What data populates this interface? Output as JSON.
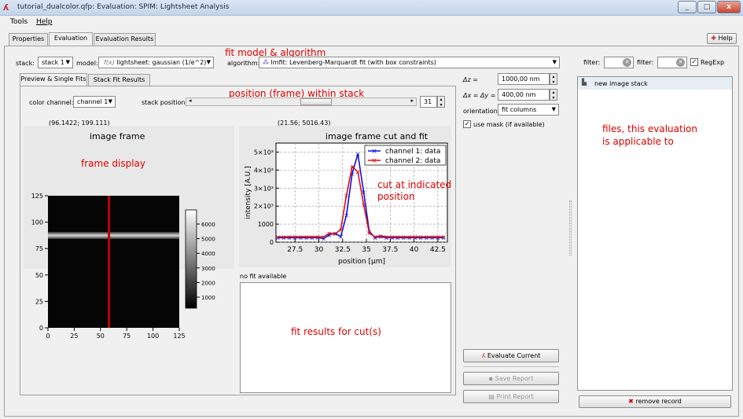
{
  "window": {
    "title": "tutorial_dualcolor.qfp: Evaluation: SPIM: Lightsheet Analysis",
    "minimize": "_",
    "maximize": "□",
    "close": "x"
  },
  "menu": {
    "items": [
      "Tools",
      "Help"
    ]
  },
  "main_tabs": {
    "properties": "Properties",
    "evaluation": "Evaluation",
    "results": "Evaluation Results",
    "help": "Help"
  },
  "top": {
    "stack_label": "stack:",
    "stack_value": "stack 1",
    "model_label": "model:",
    "model_value": "lightsheet: gaussian (1/e^2)",
    "algorithm_label": "algorithm:",
    "algorithm_value": "lmfit: Levenberg-Marquardt fit (with box constraints)",
    "annotation": "fit model & algorithm"
  },
  "sub_tabs": {
    "preview": "Preview & Single Fits",
    "stack_fit": "Stack Fit Results"
  },
  "controls": {
    "color_label": "color channel:",
    "color_value": "channel 1",
    "position_label": "stack position:",
    "position_value": "31",
    "annotation": "position (frame) within stack"
  },
  "image_panel": {
    "coord": "(96.1422; 199.111)",
    "title": "image frame",
    "annotation": "frame display",
    "y_ticks": [
      "125",
      "100",
      "75",
      "50",
      "25",
      "0"
    ],
    "x_ticks": [
      "0",
      "25",
      "50",
      "75",
      "100",
      "125"
    ],
    "colorbar_ticks": [
      "6000",
      "5000",
      "4000",
      "3000",
      "2000",
      "1000"
    ]
  },
  "cut_panel": {
    "coord": "(21.56; 5016.43)",
    "title": "image frame cut and fit",
    "annotation_line1": "cut at indicated",
    "annotation_line2": "position",
    "no_fit": "no fit available"
  },
  "chart_data": {
    "type": "line",
    "title": "image frame cut and fit",
    "xlabel": "position [µm]",
    "ylabel": "intensity [A.U.]",
    "xlim": [
      25.5,
      43.5
    ],
    "ylim": [
      0,
      5500
    ],
    "x_tick_labels": [
      "27.5",
      "30",
      "32.5",
      "35",
      "37.5",
      "40",
      "42.5"
    ],
    "y_tick_labels": [
      "0",
      "1000",
      "2×10³",
      "3×10³",
      "4×10³",
      "5×10³"
    ],
    "grid": true,
    "legend": "top-right",
    "x": [
      25.7,
      26.3,
      26.9,
      27.5,
      28.1,
      28.7,
      29.3,
      29.9,
      30.5,
      31.1,
      31.7,
      32.3,
      32.9,
      33.5,
      34.1,
      34.7,
      35.3,
      35.9,
      36.5,
      37.1,
      37.7,
      38.3,
      38.9,
      39.5,
      40.1,
      40.7,
      41.3,
      41.9,
      42.5,
      43.1
    ],
    "series": [
      {
        "name": "channel 1: data",
        "color": "#1010e0",
        "values": [
          250,
          250,
          250,
          250,
          250,
          250,
          250,
          250,
          200,
          400,
          500,
          300,
          1500,
          3800,
          4900,
          2800,
          600,
          250,
          300,
          250,
          250,
          250,
          250,
          250,
          250,
          250,
          250,
          250,
          250,
          250
        ]
      },
      {
        "name": "channel 2: data",
        "color": "#e01010",
        "values": [
          300,
          300,
          300,
          300,
          300,
          300,
          300,
          300,
          300,
          500,
          450,
          700,
          2600,
          4200,
          3900,
          2100,
          500,
          300,
          350,
          300,
          300,
          300,
          300,
          300,
          300,
          300,
          300,
          300,
          300,
          300
        ]
      }
    ]
  },
  "fit_results": {
    "annotation": "fit results for cut(s)"
  },
  "settings": {
    "dz_label": "Δz =",
    "dz_value": "1000,00 nm",
    "dxy_label": "Δx = Δy =",
    "dxy_value": "400,00 nm",
    "orientation_label": "orientation:",
    "orientation_value": "fit columns",
    "mask_label": "use mask (if available)"
  },
  "buttons": {
    "evaluate": "Evaluate Current",
    "save": "Save Report",
    "print": "Print Report",
    "remove": "remove record"
  },
  "right_panel": {
    "filter1_label": "filter:",
    "filter2_label": "filter:",
    "regexp_label": "RegExp",
    "list_item": "new image stack",
    "annotation_line1": "files, this evaluation",
    "annotation_line2": "is applicable to"
  },
  "colors": {
    "accent_red": "#e00000",
    "ch1": "#1010e0",
    "ch2": "#e01010"
  }
}
